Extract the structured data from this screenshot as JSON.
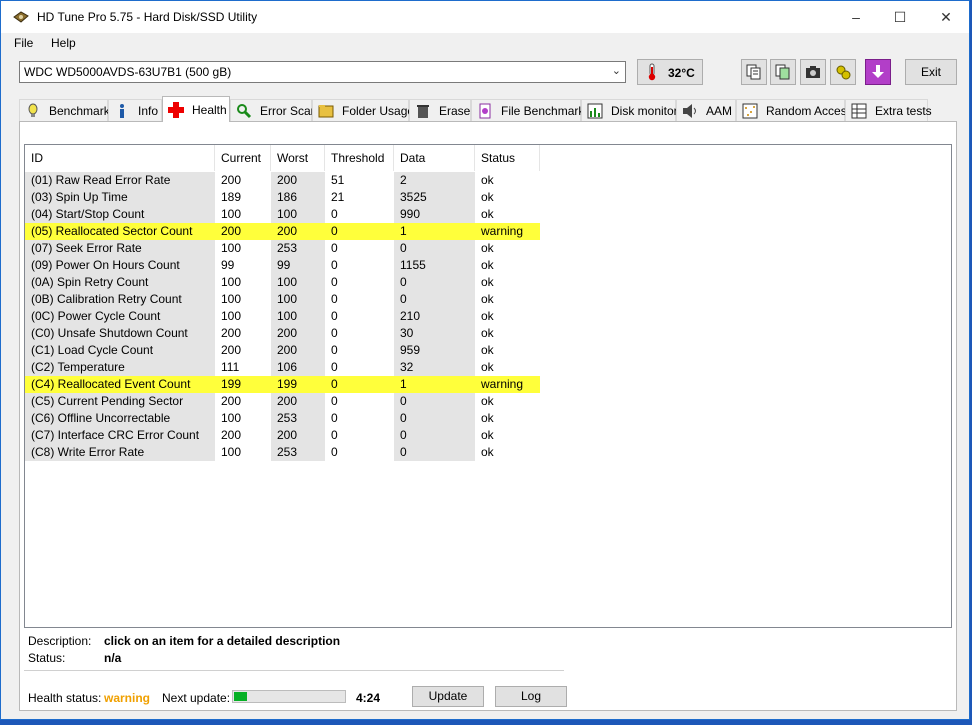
{
  "window": {
    "title": "HD Tune Pro 5.75 - Hard Disk/SSD Utility"
  },
  "menu": {
    "file": "File",
    "help": "Help"
  },
  "toolbar": {
    "drive": "WDC WD5000AVDS-63U7B1 (500 gB)",
    "temperature": "32°C",
    "exit_label": "Exit",
    "icons": [
      "copy-text-icon",
      "copy-screenshot-icon",
      "camera-icon",
      "settings-icon",
      "save-icon"
    ]
  },
  "tabs": [
    {
      "label": "Benchmark",
      "icon": "benchmark-icon"
    },
    {
      "label": "Info",
      "icon": "info-icon"
    },
    {
      "label": "Health",
      "icon": "health-icon"
    },
    {
      "label": "Error Scan",
      "icon": "error-scan-icon"
    },
    {
      "label": "Folder Usage",
      "icon": "folder-icon"
    },
    {
      "label": "Erase",
      "icon": "erase-icon"
    },
    {
      "label": "File Benchmark",
      "icon": "file-benchmark-icon"
    },
    {
      "label": "Disk monitor",
      "icon": "disk-monitor-icon"
    },
    {
      "label": "AAM",
      "icon": "speaker-icon"
    },
    {
      "label": "Random Access",
      "icon": "random-access-icon"
    },
    {
      "label": "Extra tests",
      "icon": "extra-tests-icon"
    }
  ],
  "active_tab": "Health",
  "table": {
    "columns": [
      "ID",
      "Current",
      "Worst",
      "Threshold",
      "Data",
      "Status"
    ],
    "rows": [
      [
        "(01) Raw Read Error Rate",
        "200",
        "200",
        "51",
        "2",
        "ok"
      ],
      [
        "(03) Spin Up Time",
        "189",
        "186",
        "21",
        "3525",
        "ok"
      ],
      [
        "(04) Start/Stop Count",
        "100",
        "100",
        "0",
        "990",
        "ok"
      ],
      [
        "(05) Reallocated Sector Count",
        "200",
        "200",
        "0",
        "1",
        "warning"
      ],
      [
        "(07) Seek Error Rate",
        "100",
        "253",
        "0",
        "0",
        "ok"
      ],
      [
        "(09) Power On Hours Count",
        "99",
        "99",
        "0",
        "1155",
        "ok"
      ],
      [
        "(0A) Spin Retry Count",
        "100",
        "100",
        "0",
        "0",
        "ok"
      ],
      [
        "(0B) Calibration Retry Count",
        "100",
        "100",
        "0",
        "0",
        "ok"
      ],
      [
        "(0C) Power Cycle Count",
        "100",
        "100",
        "0",
        "210",
        "ok"
      ],
      [
        "(C0) Unsafe Shutdown Count",
        "200",
        "200",
        "0",
        "30",
        "ok"
      ],
      [
        "(C1) Load Cycle Count",
        "200",
        "200",
        "0",
        "959",
        "ok"
      ],
      [
        "(C2) Temperature",
        "111",
        "106",
        "0",
        "32",
        "ok"
      ],
      [
        "(C4) Reallocated Event Count",
        "199",
        "199",
        "0",
        "1",
        "warning"
      ],
      [
        "(C5) Current Pending Sector",
        "200",
        "200",
        "0",
        "0",
        "ok"
      ],
      [
        "(C6) Offline Uncorrectable",
        "100",
        "253",
        "0",
        "0",
        "ok"
      ],
      [
        "(C7) Interface CRC Error Count",
        "200",
        "200",
        "0",
        "0",
        "ok"
      ],
      [
        "(C8) Write Error Rate",
        "100",
        "253",
        "0",
        "0",
        "ok"
      ]
    ]
  },
  "details": {
    "description_label": "Description:",
    "description_value": "click on an item for a detailed description",
    "status_label": "Status:",
    "status_value": "n/a"
  },
  "footer": {
    "health_label": "Health status:",
    "health_value": "warning",
    "next_update_label": "Next update:",
    "next_update_progress": 0.12,
    "next_update_time": "4:24",
    "update_label": "Update",
    "log_label": "Log"
  },
  "colors": {
    "warning_highlight": "#ffff3b",
    "warning_text": "#f0a000",
    "progress_fill": "#06b025",
    "desktop": "#1d57b8"
  }
}
